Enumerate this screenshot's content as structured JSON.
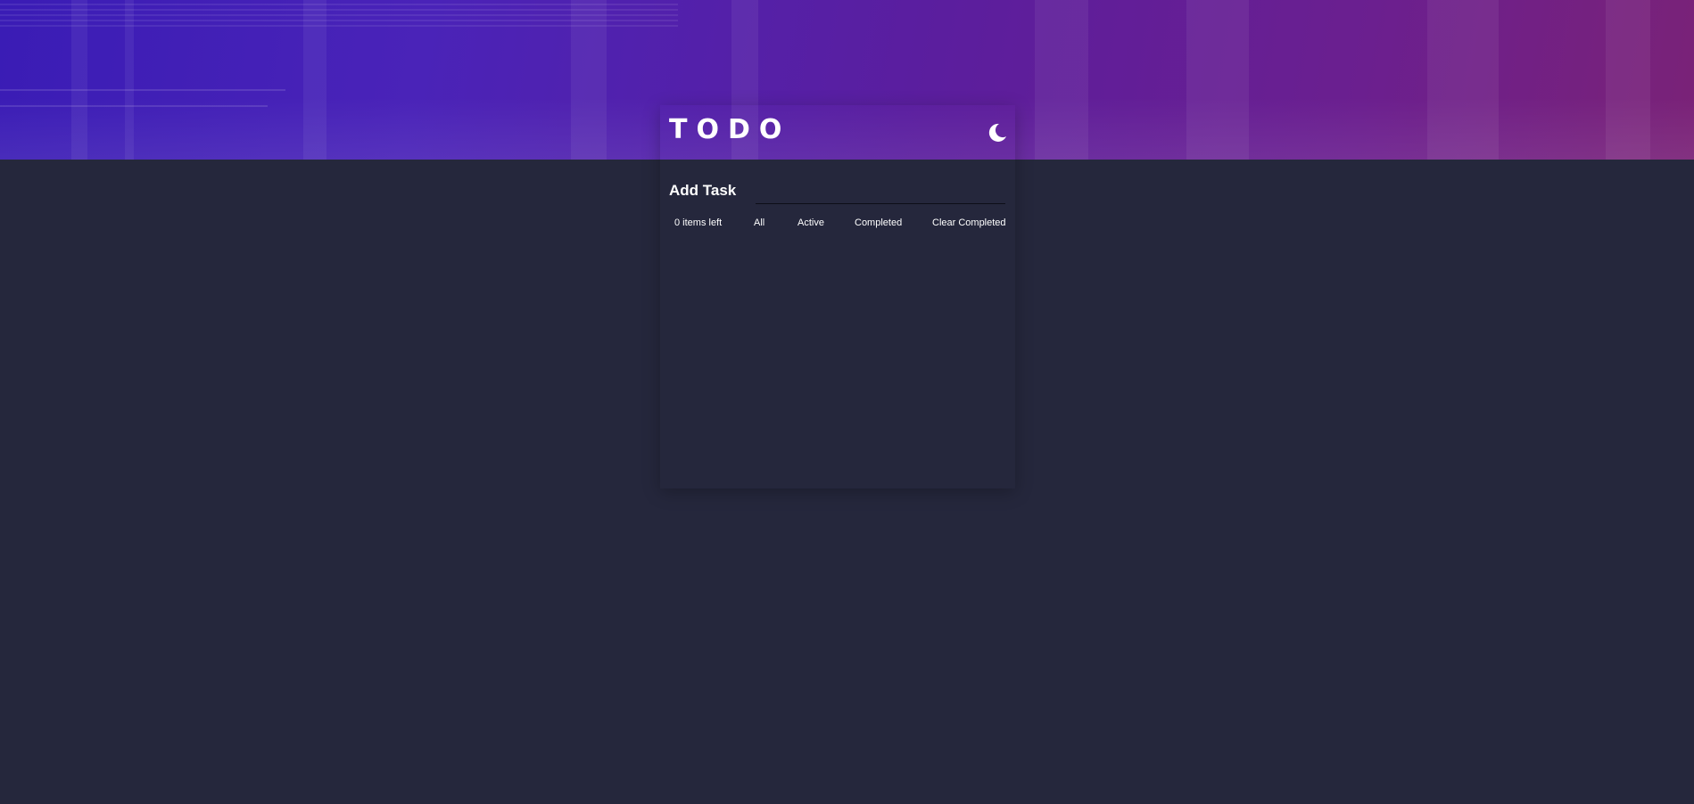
{
  "header": {
    "title": "TODO",
    "theme_toggle_icon": "moon-icon"
  },
  "add_task": {
    "label": "Add Task",
    "input_value": "",
    "input_placeholder": ""
  },
  "footer": {
    "items_left": "0 items left",
    "filter_all": "All",
    "filter_active": "Active",
    "filter_completed": "Completed",
    "clear_completed": "Clear Completed"
  },
  "colors": {
    "background": "#25273c",
    "gradient_start": "#3a1cb5",
    "gradient_end": "#7a2277",
    "text": "#ffffff"
  }
}
